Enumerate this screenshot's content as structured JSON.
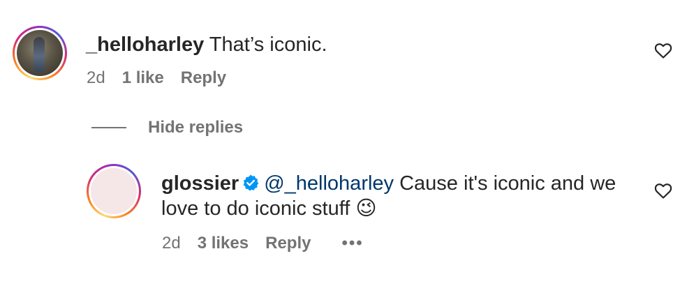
{
  "comment": {
    "username": "_helloharley",
    "text": "That’s iconic.",
    "time": "2d",
    "likes": "1 like",
    "reply_label": "Reply",
    "avatar": "user-photo"
  },
  "replies_toggle": {
    "label": "Hide replies"
  },
  "reply": {
    "username": "glossier",
    "verified": true,
    "mention": "@_helloharley",
    "text": "Cause it's iconic and we love to do iconic stuff 😉",
    "time": "2d",
    "likes": "3 likes",
    "reply_label": "Reply",
    "more": "•••",
    "avatar": "pink-brand-logo"
  },
  "icons": {
    "heart": "heart-outline-icon",
    "verified": "verified-badge-icon",
    "more": "more-dots-icon"
  },
  "colors": {
    "text": "#262626",
    "meta": "#737373",
    "mention": "#00376b",
    "verified": "#0095f6",
    "avatar_pink": "#f5e6e8"
  }
}
